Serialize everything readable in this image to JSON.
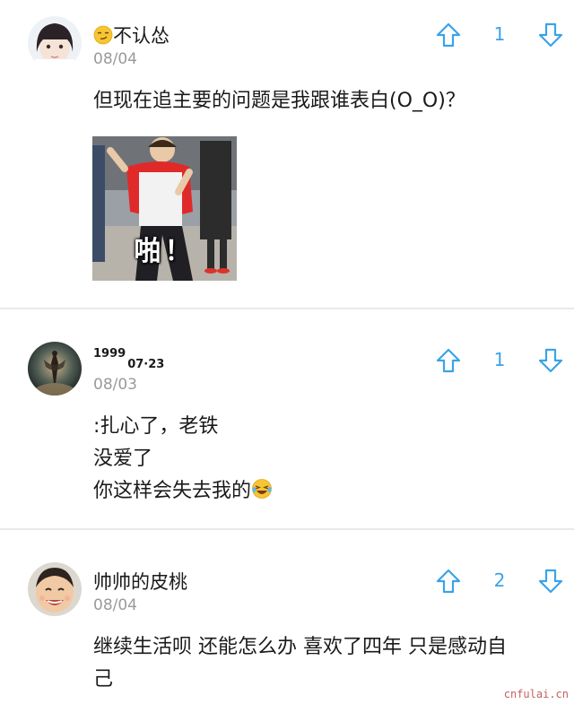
{
  "colors": {
    "accent": "#3aa3e8",
    "meta_text": "#9a9a9a",
    "divider": "#e9e9e9",
    "watermark": "#c46060"
  },
  "comments": [
    {
      "username": "不认怂",
      "username_prefix_icon": "smirk-emoji-icon",
      "date": "08/04",
      "lines": [
        "但现在追主要的问题是我跟谁表白(O_O)？"
      ],
      "image_caption": "啪！",
      "vote_count": "1"
    },
    {
      "username_a": "1999",
      "username_b": "07·23",
      "date": "08/03",
      "lines": [
        ":扎心了，老铁",
        "没爱了",
        "你这样会失去我的"
      ],
      "trailing_emoji_icon": "laughing-tears-emoji-icon",
      "vote_count": "1"
    },
    {
      "username": "帅帅的皮桃",
      "date": "08/04",
      "lines": [
        "继续生活呗 还能怎么办 喜欢了四年 只是感动自",
        "己"
      ],
      "vote_count": "2"
    }
  ],
  "watermark": "cnfulai.cn"
}
